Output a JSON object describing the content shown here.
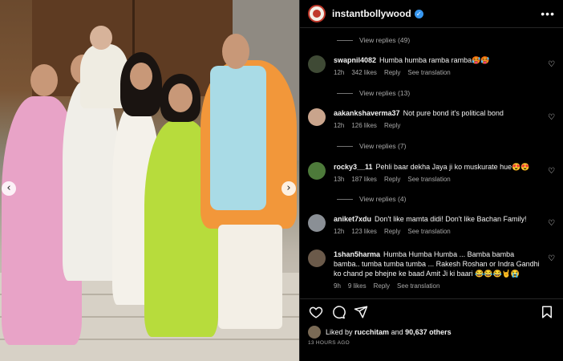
{
  "post": {
    "username": "instantbollywood",
    "more_label": "•••",
    "liked_by_prefix": "Liked by",
    "liked_by_user": "rucchitam",
    "liked_by_suffix": "and",
    "liked_by_count": "90,637 others",
    "timestamp": "13 HOURS AGO"
  },
  "icons": {
    "verified": "verified-badge-icon",
    "like": "heart-icon",
    "comment": "comment-bubble-icon",
    "share": "paper-plane-icon",
    "save": "bookmark-icon",
    "prev": "chevron-left-icon",
    "next": "chevron-right-icon"
  },
  "colors": {
    "verified": "#3797f0",
    "background": "#000000",
    "muted": "#a8a8a8"
  },
  "replies": [
    {
      "label": "View replies (49)"
    },
    {
      "label": "View replies (13)"
    },
    {
      "label": "View replies (7)"
    },
    {
      "label": "View replies (4)"
    }
  ],
  "comments": [
    {
      "user": "swapnil4082",
      "text": "Humba humba ramba ramba🥵🥵",
      "time": "12h",
      "likes": "342 likes",
      "reply": "Reply",
      "translate": "See translation"
    },
    {
      "user": "aakankshaverma37",
      "text": "Not pure bond it's political bond",
      "time": "12h",
      "likes": "126 likes",
      "reply": "Reply",
      "translate": ""
    },
    {
      "user": "rocky3__11",
      "text": "Pehli baar dekha Jaya ji ko muskurate hue😍😍",
      "time": "13h",
      "likes": "187 likes",
      "reply": "Reply",
      "translate": "See translation"
    },
    {
      "user": "aniket7xdu",
      "text": "Don't like mamta didi! Don't like Bachan Family!",
      "time": "12h",
      "likes": "123 likes",
      "reply": "Reply",
      "translate": "See translation"
    },
    {
      "user": "1shan5harma",
      "text": "Humba Humba Humba ... Bamba bamba bamba.. tumba tumba tumba ... Rakesh Roshan or Indra Gandhi ko chand pe bhejne ke baad Amit Ji ki baari 😂😂😂🤘😭",
      "time": "9h",
      "likes": "9 likes",
      "reply": "Reply",
      "translate": "See translation"
    }
  ]
}
